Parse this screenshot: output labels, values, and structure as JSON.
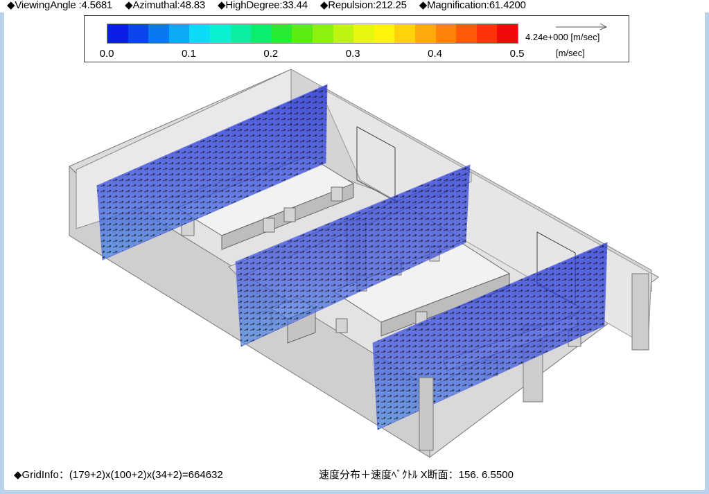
{
  "header": {
    "viewing_angle": "◆ViewingAngle :4.5681",
    "azimuthal": "◆Azimuthal:48.83",
    "high_degree": "◆HighDegree:33.44",
    "repulsion": "◆Repulsion:212.25",
    "magnification": "◆Magnification:61.4200"
  },
  "legend": {
    "ticks": [
      "0.0",
      "0.1",
      "0.2",
      "0.3",
      "0.4",
      "0.5"
    ],
    "reference_value": "4.24e+000  [m/sec]",
    "unit": "[m/sec]",
    "colors": [
      "#0a1ee8",
      "#0a46ec",
      "#0a78f0",
      "#0aaaf4",
      "#0adcf6",
      "#0af0d2",
      "#0af0a0",
      "#0aee6e",
      "#28ec32",
      "#5aee10",
      "#8cf010",
      "#bef410",
      "#e6f60e",
      "#fff40a",
      "#ffd20a",
      "#ffaa0a",
      "#ff820a",
      "#ff5a0a",
      "#ff320a",
      "#f00a0a"
    ]
  },
  "status": {
    "grid_info": "◆GridInfo：(179+2)x(100+2)x(34+2)=664632",
    "section_info": "速度分布＋速度ﾍﾞｸﾄﾙ X断面：156.  6.5500"
  }
}
